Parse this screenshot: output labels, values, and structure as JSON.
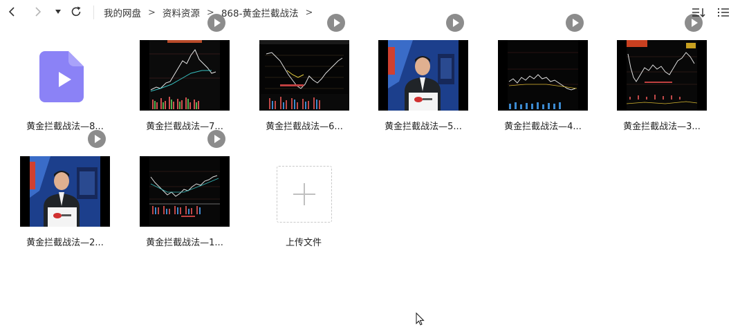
{
  "breadcrumb": {
    "items": [
      "我的网盘",
      "资料资源",
      "868-黄金拦截战法"
    ],
    "separator": ">"
  },
  "files": [
    {
      "name": "黄金拦截战法—8...",
      "kind": "file-doc"
    },
    {
      "name": "黄金拦截战法—7...",
      "kind": "video-chart"
    },
    {
      "name": "黄金拦截战法—6...",
      "kind": "video-chart"
    },
    {
      "name": "黄金拦截战法—5...",
      "kind": "video-presenter"
    },
    {
      "name": "黄金拦截战法—4...",
      "kind": "video-chart"
    },
    {
      "name": "黄金拦截战法—3...",
      "kind": "video-chart"
    },
    {
      "name": "黄金拦截战法—2...",
      "kind": "video-presenter"
    },
    {
      "name": "黄金拦截战法—1...",
      "kind": "video-chart"
    }
  ],
  "upload": {
    "label": "上传文件"
  },
  "colors": {
    "accent": "#8b82f6",
    "border": "#e2e2e2",
    "text": "#222222"
  }
}
